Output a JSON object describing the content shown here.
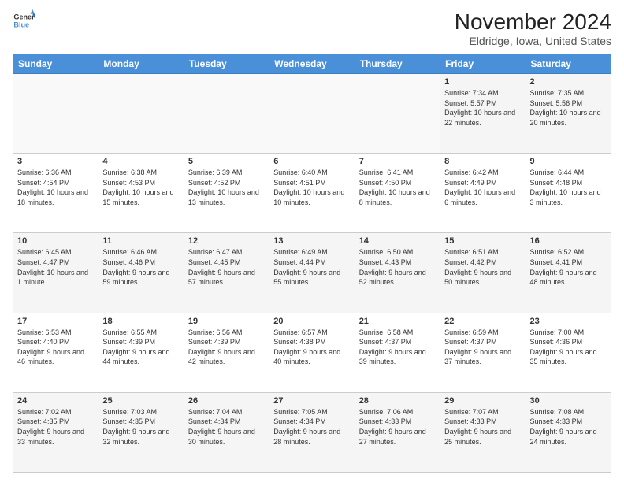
{
  "logo": {
    "line1": "General",
    "line2": "Blue"
  },
  "title": "November 2024",
  "subtitle": "Eldridge, Iowa, United States",
  "days_header": [
    "Sunday",
    "Monday",
    "Tuesday",
    "Wednesday",
    "Thursday",
    "Friday",
    "Saturday"
  ],
  "weeks": [
    [
      {
        "day": "",
        "info": ""
      },
      {
        "day": "",
        "info": ""
      },
      {
        "day": "",
        "info": ""
      },
      {
        "day": "",
        "info": ""
      },
      {
        "day": "",
        "info": ""
      },
      {
        "day": "1",
        "info": "Sunrise: 7:34 AM\nSunset: 5:57 PM\nDaylight: 10 hours and 22 minutes."
      },
      {
        "day": "2",
        "info": "Sunrise: 7:35 AM\nSunset: 5:56 PM\nDaylight: 10 hours and 20 minutes."
      }
    ],
    [
      {
        "day": "3",
        "info": "Sunrise: 6:36 AM\nSunset: 4:54 PM\nDaylight: 10 hours and 18 minutes."
      },
      {
        "day": "4",
        "info": "Sunrise: 6:38 AM\nSunset: 4:53 PM\nDaylight: 10 hours and 15 minutes."
      },
      {
        "day": "5",
        "info": "Sunrise: 6:39 AM\nSunset: 4:52 PM\nDaylight: 10 hours and 13 minutes."
      },
      {
        "day": "6",
        "info": "Sunrise: 6:40 AM\nSunset: 4:51 PM\nDaylight: 10 hours and 10 minutes."
      },
      {
        "day": "7",
        "info": "Sunrise: 6:41 AM\nSunset: 4:50 PM\nDaylight: 10 hours and 8 minutes."
      },
      {
        "day": "8",
        "info": "Sunrise: 6:42 AM\nSunset: 4:49 PM\nDaylight: 10 hours and 6 minutes."
      },
      {
        "day": "9",
        "info": "Sunrise: 6:44 AM\nSunset: 4:48 PM\nDaylight: 10 hours and 3 minutes."
      }
    ],
    [
      {
        "day": "10",
        "info": "Sunrise: 6:45 AM\nSunset: 4:47 PM\nDaylight: 10 hours and 1 minute."
      },
      {
        "day": "11",
        "info": "Sunrise: 6:46 AM\nSunset: 4:46 PM\nDaylight: 9 hours and 59 minutes."
      },
      {
        "day": "12",
        "info": "Sunrise: 6:47 AM\nSunset: 4:45 PM\nDaylight: 9 hours and 57 minutes."
      },
      {
        "day": "13",
        "info": "Sunrise: 6:49 AM\nSunset: 4:44 PM\nDaylight: 9 hours and 55 minutes."
      },
      {
        "day": "14",
        "info": "Sunrise: 6:50 AM\nSunset: 4:43 PM\nDaylight: 9 hours and 52 minutes."
      },
      {
        "day": "15",
        "info": "Sunrise: 6:51 AM\nSunset: 4:42 PM\nDaylight: 9 hours and 50 minutes."
      },
      {
        "day": "16",
        "info": "Sunrise: 6:52 AM\nSunset: 4:41 PM\nDaylight: 9 hours and 48 minutes."
      }
    ],
    [
      {
        "day": "17",
        "info": "Sunrise: 6:53 AM\nSunset: 4:40 PM\nDaylight: 9 hours and 46 minutes."
      },
      {
        "day": "18",
        "info": "Sunrise: 6:55 AM\nSunset: 4:39 PM\nDaylight: 9 hours and 44 minutes."
      },
      {
        "day": "19",
        "info": "Sunrise: 6:56 AM\nSunset: 4:39 PM\nDaylight: 9 hours and 42 minutes."
      },
      {
        "day": "20",
        "info": "Sunrise: 6:57 AM\nSunset: 4:38 PM\nDaylight: 9 hours and 40 minutes."
      },
      {
        "day": "21",
        "info": "Sunrise: 6:58 AM\nSunset: 4:37 PM\nDaylight: 9 hours and 39 minutes."
      },
      {
        "day": "22",
        "info": "Sunrise: 6:59 AM\nSunset: 4:37 PM\nDaylight: 9 hours and 37 minutes."
      },
      {
        "day": "23",
        "info": "Sunrise: 7:00 AM\nSunset: 4:36 PM\nDaylight: 9 hours and 35 minutes."
      }
    ],
    [
      {
        "day": "24",
        "info": "Sunrise: 7:02 AM\nSunset: 4:35 PM\nDaylight: 9 hours and 33 minutes."
      },
      {
        "day": "25",
        "info": "Sunrise: 7:03 AM\nSunset: 4:35 PM\nDaylight: 9 hours and 32 minutes."
      },
      {
        "day": "26",
        "info": "Sunrise: 7:04 AM\nSunset: 4:34 PM\nDaylight: 9 hours and 30 minutes."
      },
      {
        "day": "27",
        "info": "Sunrise: 7:05 AM\nSunset: 4:34 PM\nDaylight: 9 hours and 28 minutes."
      },
      {
        "day": "28",
        "info": "Sunrise: 7:06 AM\nSunset: 4:33 PM\nDaylight: 9 hours and 27 minutes."
      },
      {
        "day": "29",
        "info": "Sunrise: 7:07 AM\nSunset: 4:33 PM\nDaylight: 9 hours and 25 minutes."
      },
      {
        "day": "30",
        "info": "Sunrise: 7:08 AM\nSunset: 4:33 PM\nDaylight: 9 hours and 24 minutes."
      }
    ]
  ]
}
